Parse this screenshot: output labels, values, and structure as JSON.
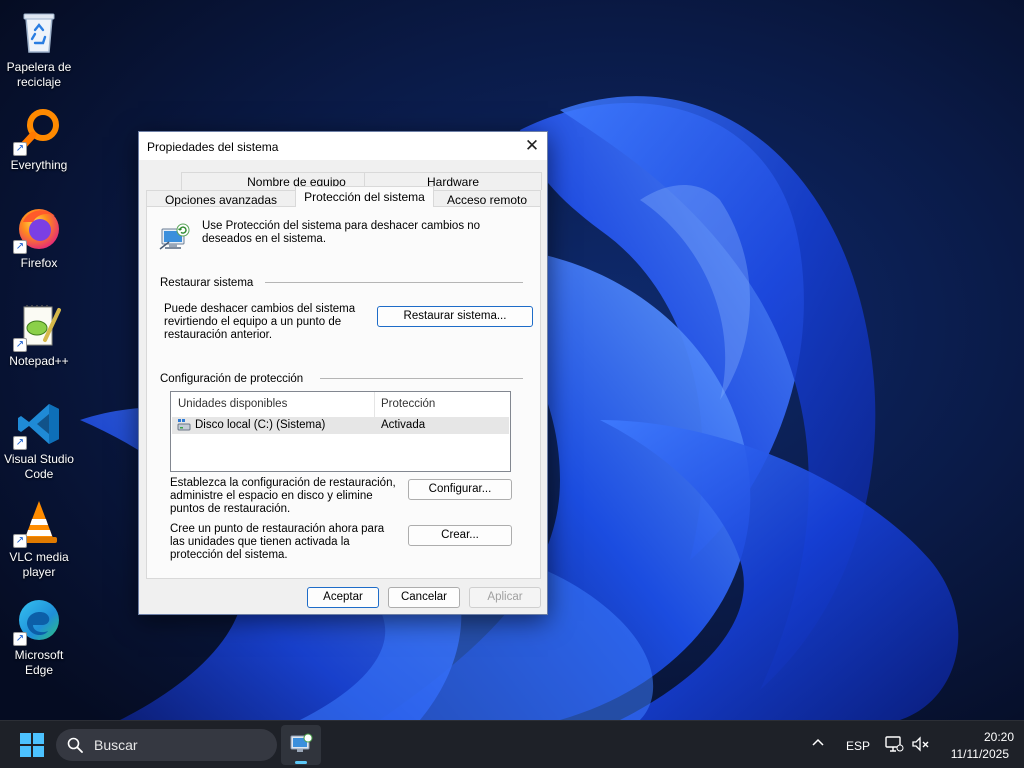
{
  "desktop": {
    "icons": [
      {
        "label": "Papelera de reciclaje",
        "icon": "recycle-bin-icon"
      },
      {
        "label": "Everything",
        "icon": "everything-search-icon"
      },
      {
        "label": "Firefox",
        "icon": "firefox-icon"
      },
      {
        "label": "Notepad++",
        "icon": "notepadpp-icon"
      },
      {
        "label": "Visual Studio Code",
        "icon": "vscode-icon"
      },
      {
        "label": "VLC media player",
        "icon": "vlc-icon"
      },
      {
        "label": "Microsoft Edge",
        "icon": "edge-icon"
      }
    ],
    "shortcut_arrow": "↗"
  },
  "dialog": {
    "title": "Propiedades del sistema",
    "close_glyph": "✕",
    "tabs_row1": [
      "Nombre de equipo",
      "Hardware"
    ],
    "tabs_row2": [
      "Opciones avanzadas",
      "Protección del sistema",
      "Acceso remoto"
    ],
    "active_tab": "Protección del sistema",
    "intro_text": "Use Protección del sistema para deshacer cambios no deseados en el sistema.",
    "restore": {
      "group_title": "Restaurar sistema",
      "description": "Puede deshacer cambios del sistema revirtiendo el equipo a un punto de restauración anterior.",
      "button": "Restaurar sistema..."
    },
    "protection": {
      "group_title": "Configuración de protección",
      "columns": [
        "Unidades disponibles",
        "Protección"
      ],
      "rows": [
        {
          "drive": "Disco local (C:) (Sistema)",
          "status": "Activada"
        }
      ],
      "configure_text": "Establezca la configuración de restauración, administre el espacio en disco y elimine puntos de restauración.",
      "configure_button": "Configurar...",
      "create_text": "Cree un punto de restauración ahora para las unidades que tienen activada la protección del sistema.",
      "create_button": "Crear..."
    },
    "buttons": {
      "ok": "Aceptar",
      "cancel": "Cancelar",
      "apply": "Aplicar"
    }
  },
  "taskbar": {
    "search_placeholder": "Buscar",
    "language": "ESP",
    "time": "20:20",
    "date": "11/11/2025",
    "tray_chevron": "^",
    "accent": "#5cc8f7"
  }
}
